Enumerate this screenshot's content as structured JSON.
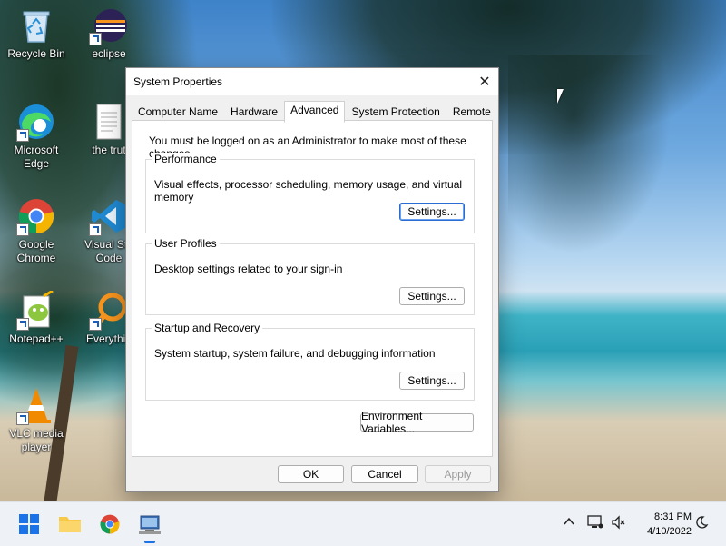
{
  "desktop": {
    "icons": [
      {
        "label": "Recycle Bin",
        "icon": "recycle-bin-icon"
      },
      {
        "label": "eclipse",
        "icon": "eclipse-icon"
      },
      {
        "label": "Microsoft Edge",
        "icon": "edge-icon"
      },
      {
        "label": "the trut",
        "icon": "text-file-icon"
      },
      {
        "label": "Google Chrome",
        "icon": "chrome-icon"
      },
      {
        "label": "Visual Stu Code",
        "icon": "vscode-icon"
      },
      {
        "label": "Notepad++",
        "icon": "notepadpp-icon"
      },
      {
        "label": "Everythin",
        "icon": "everything-search-icon"
      },
      {
        "label": "VLC media player",
        "icon": "vlc-icon"
      }
    ]
  },
  "dialog": {
    "title": "System Properties",
    "close_glyph": "✕",
    "tabs": [
      {
        "label": "Computer Name"
      },
      {
        "label": "Hardware"
      },
      {
        "label": "Advanced"
      },
      {
        "label": "System Protection"
      },
      {
        "label": "Remote"
      }
    ],
    "active_tab": "Advanced",
    "notice": "You must be logged on as an Administrator to make most of these changes.",
    "groups": [
      {
        "title": "Performance",
        "description": "Visual effects, processor scheduling, memory usage, and virtual memory",
        "button": "Settings..."
      },
      {
        "title": "User Profiles",
        "description": "Desktop settings related to your sign-in",
        "button": "Settings..."
      },
      {
        "title": "Startup and Recovery",
        "description": "System startup, system failure, and debugging information",
        "button": "Settings..."
      }
    ],
    "env_button": "Environment Variables...",
    "ok_button": "OK",
    "cancel_button": "Cancel",
    "apply_button": "Apply"
  },
  "taskbar": {
    "time": "8:31 PM",
    "date": "4/10/2022",
    "accent": "#1a73e8"
  }
}
